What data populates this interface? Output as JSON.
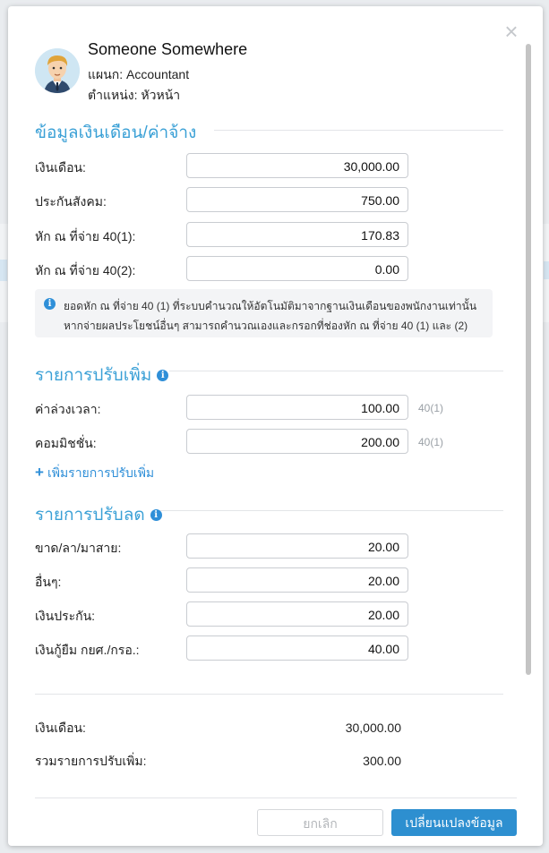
{
  "employee": {
    "name": "Someone Somewhere",
    "department": "แผนก: Accountant",
    "position": "ตำแหน่ง: หัวหน้า"
  },
  "salary_section": {
    "title": "ข้อมูลเงินเดือน/ค่าจ้าง",
    "fields": [
      {
        "label": "เงินเดือน:",
        "value": "30,000.00"
      },
      {
        "label": "ประกันสังคม:",
        "value": "750.00"
      },
      {
        "label": "หัก ณ ที่จ่าย 40(1):",
        "value": "170.83"
      },
      {
        "label": "หัก ณ ที่จ่าย 40(2):",
        "value": "0.00"
      }
    ],
    "note_line1": "ยอดหัก ณ ที่จ่าย 40 (1) ที่ระบบคำนวณให้อัตโนมัติมาจากฐานเงินเดือนของพนักงานเท่านั้น",
    "note_line2": "หากจ่ายผลประโยชน์อื่นๆ สามารถคำนวณเองและกรอกที่ช่องหัก ณ ที่จ่าย 40 (1) และ (2)"
  },
  "additions_section": {
    "title": "รายการปรับเพิ่ม",
    "fields": [
      {
        "label": "ค่าล่วงเวลา:",
        "value": "100.00",
        "suffix": "40(1)"
      },
      {
        "label": "คอมมิชชั่น:",
        "value": "200.00",
        "suffix": "40(1)"
      }
    ],
    "add_link": "เพิ่มรายการปรับเพิ่ม"
  },
  "deductions_section": {
    "title": "รายการปรับลด",
    "fields": [
      {
        "label": "ขาด/ลา/มาสาย:",
        "value": "20.00"
      },
      {
        "label": "อื่นๆ:",
        "value": "20.00"
      },
      {
        "label": "เงินประกัน:",
        "value": "20.00"
      },
      {
        "label": "เงินกู้ยืม กยศ./กรอ.:",
        "value": "40.00"
      }
    ]
  },
  "summary": [
    {
      "label": "เงินเดือน:",
      "value": "30,000.00"
    },
    {
      "label": "รวมรายการปรับเพิ่ม:",
      "value": "300.00"
    }
  ],
  "footer": {
    "cancel_label": "ยกเลิก",
    "save_label": "เปลี่ยนแปลงข้อมูล"
  },
  "icons": {
    "close": "close-icon",
    "info": "info-icon",
    "plus": "plus-icon"
  }
}
